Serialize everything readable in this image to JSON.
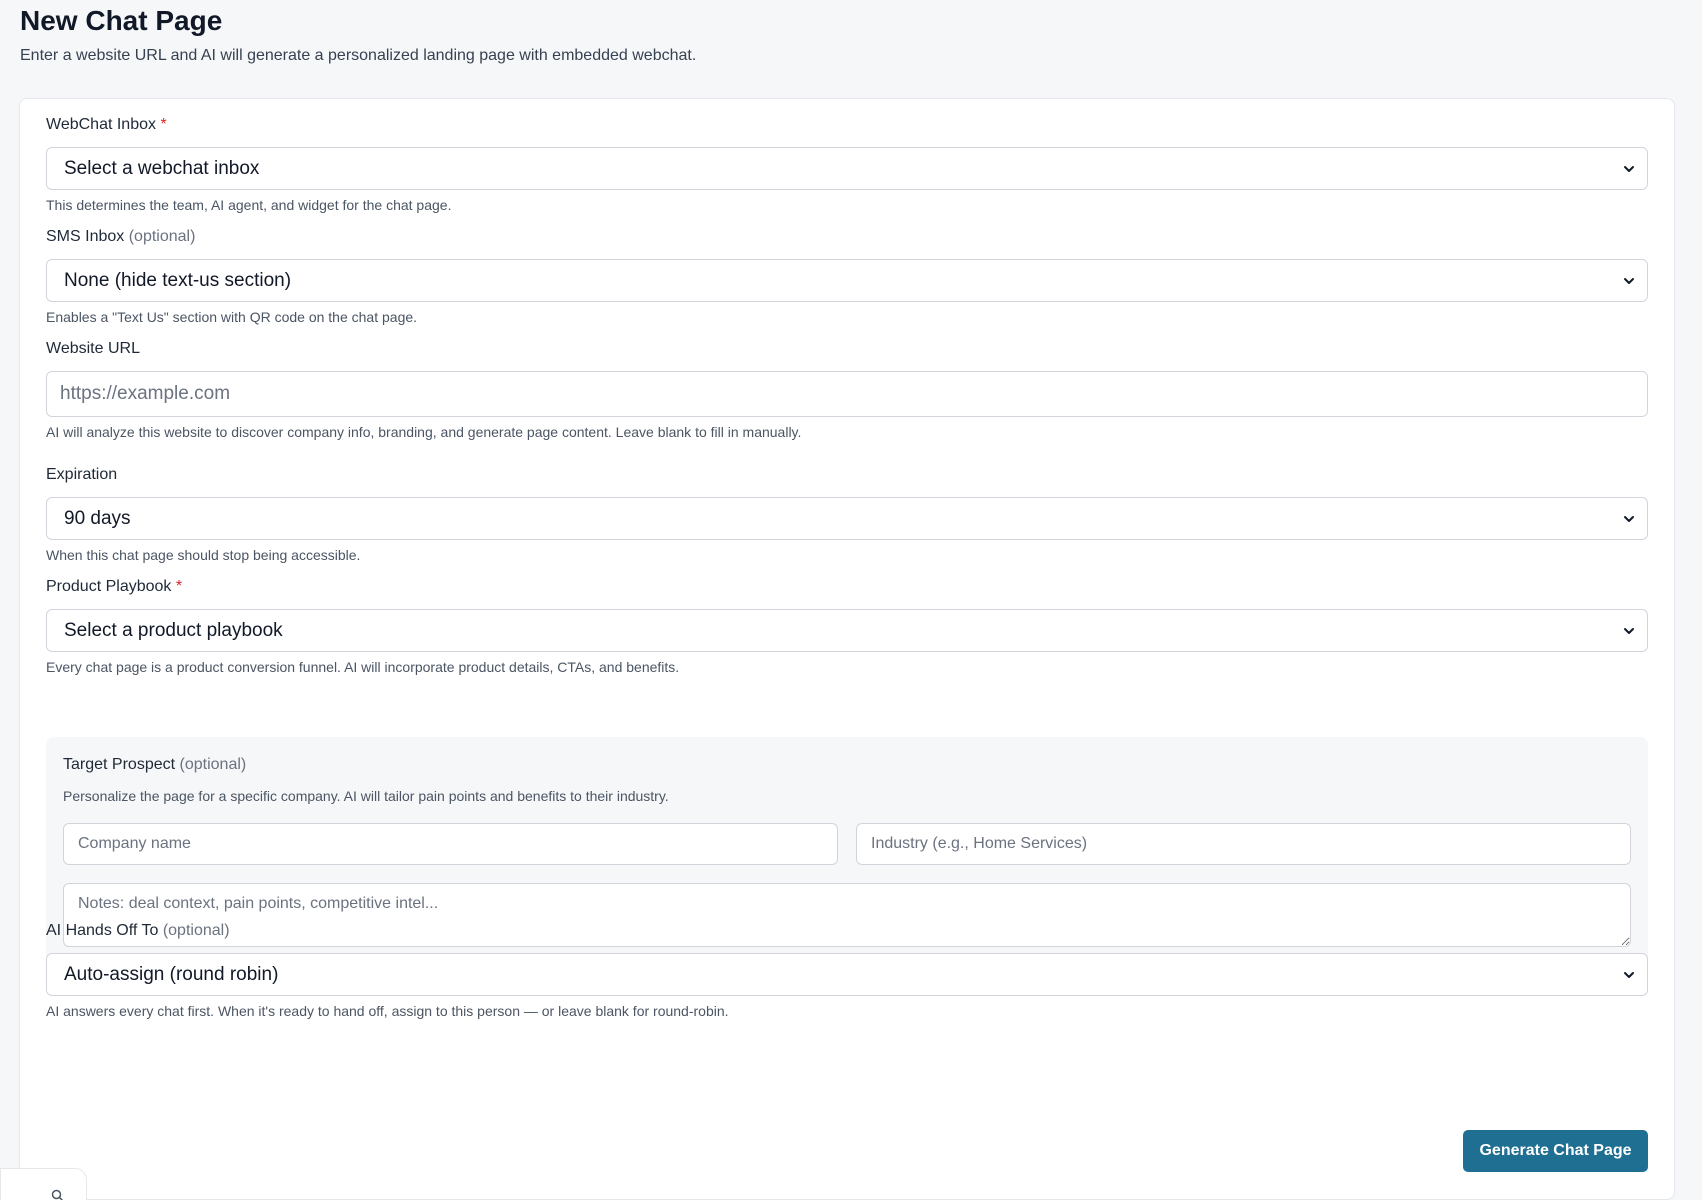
{
  "header": {
    "title": "New Chat Page",
    "subtitle": "Enter a website URL and AI will generate a personalized landing page with embedded webchat."
  },
  "form": {
    "webchat_inbox": {
      "label": "WebChat Inbox",
      "required_mark": "*",
      "selected": "Select a webchat inbox",
      "help": "This determines the team, AI agent, and widget for the chat page."
    },
    "sms_inbox": {
      "label": "SMS Inbox",
      "optional_tag": "(optional)",
      "selected": "None (hide text-us section)",
      "help": "Enables a \"Text Us\" section with QR code on the chat page."
    },
    "website_url": {
      "label": "Website URL",
      "value": "",
      "placeholder": "https://example.com",
      "help": "AI will analyze this website to discover company info, branding, and generate page content. Leave blank to fill in manually."
    },
    "expiration": {
      "label": "Expiration",
      "selected": "90 days",
      "help": "When this chat page should stop being accessible."
    },
    "product_playbook": {
      "label": "Product Playbook",
      "required_mark": "*",
      "selected": "Select a product playbook",
      "help": "Every chat page is a product conversion funnel. AI will incorporate product details, CTAs, and benefits."
    },
    "target_prospect": {
      "label": "Target Prospect",
      "optional_tag": "(optional)",
      "help": "Personalize the page for a specific company. AI will tailor pain points and benefits to their industry.",
      "company_placeholder": "Company name",
      "industry_placeholder": "Industry (e.g., Home Services)",
      "notes_placeholder": "Notes: deal context, pain points, competitive intel..."
    },
    "handoff": {
      "label": "AI Hands Off To",
      "optional_tag": "(optional)",
      "selected": "Auto-assign (round robin)",
      "help": "AI answers every chat first. When it's ready to hand off, assign to this person — or leave blank for round-robin."
    },
    "submit_label": "Generate Chat Page"
  },
  "icons": {
    "select_chevron": "chevron-down-icon",
    "search": "search-icon"
  },
  "colors": {
    "accent": "#1f6f93",
    "required": "#dc2626",
    "background": "#f6f7f9"
  }
}
